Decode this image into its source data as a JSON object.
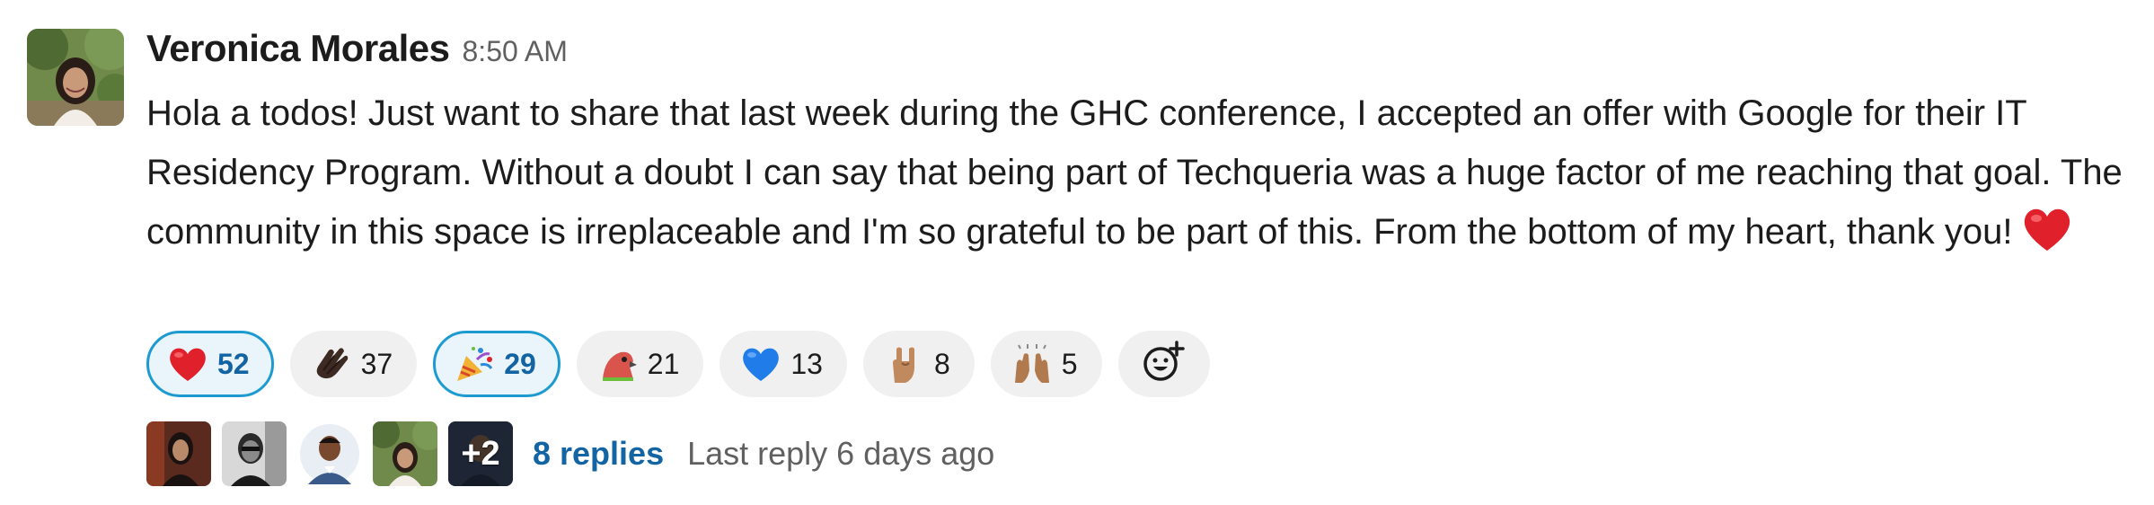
{
  "message": {
    "author": "Veronica Morales",
    "timestamp": "8:50 AM",
    "text": "Hola a todos! Just want to share that last week during the GHC conference, I  accepted an offer with Google for their IT Residency Program. Without a doubt I can say that being part of Techqueria was a huge factor of me reaching that goal. The community in this space is irreplaceable and I'm so grateful to be part of this. From the bottom of my heart, thank you!",
    "inline_emoji": "red-heart-icon"
  },
  "reactions": [
    {
      "emoji": "red-heart-icon",
      "count": "52",
      "active": true
    },
    {
      "emoji": "clapping-hands-dark-icon",
      "count": "37",
      "active": false
    },
    {
      "emoji": "party-popper-icon",
      "count": "29",
      "active": true
    },
    {
      "emoji": "party-parrot-icon",
      "count": "21",
      "active": false
    },
    {
      "emoji": "blue-heart-icon",
      "count": "13",
      "active": false
    },
    {
      "emoji": "rock-on-hand-icon",
      "count": "8",
      "active": false
    },
    {
      "emoji": "raised-hands-icon",
      "count": "5",
      "active": false
    }
  ],
  "thread": {
    "more_participants": "+2",
    "replies_label": "8 replies",
    "last_reply": "Last reply 6 days ago"
  },
  "colors": {
    "accent_blue": "#1264a3",
    "active_border": "#1d9bd1",
    "pill_bg": "#f0f0f0",
    "muted_text": "#616061"
  }
}
